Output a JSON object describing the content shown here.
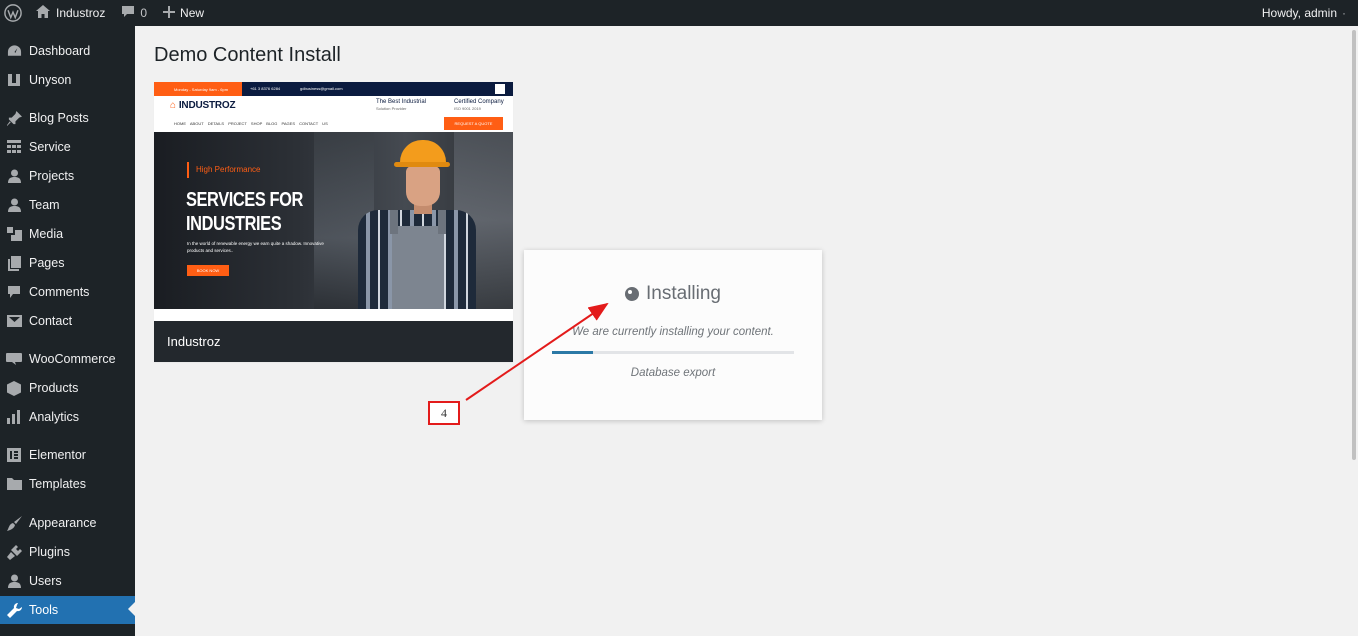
{
  "adminbar": {
    "site_name": "Industroz",
    "comments_count": "0",
    "new_label": "New",
    "greeting": "Howdy, admin",
    "greeting_suffix": "·"
  },
  "sidebar": {
    "items": [
      {
        "label": "Dashboard",
        "icon": "dashboard-icon"
      },
      {
        "label": "Unyson",
        "icon": "unyson-icon"
      },
      {
        "label": "Blog Posts",
        "icon": "pin-icon"
      },
      {
        "label": "Service",
        "icon": "grid-icon"
      },
      {
        "label": "Projects",
        "icon": "person-icon"
      },
      {
        "label": "Team",
        "icon": "person-icon"
      },
      {
        "label": "Media",
        "icon": "media-icon"
      },
      {
        "label": "Pages",
        "icon": "pages-icon"
      },
      {
        "label": "Comments",
        "icon": "comment-icon"
      },
      {
        "label": "Contact",
        "icon": "mail-icon"
      },
      {
        "label": "WooCommerce",
        "icon": "woo-icon"
      },
      {
        "label": "Products",
        "icon": "box-icon"
      },
      {
        "label": "Analytics",
        "icon": "bar-chart-icon"
      },
      {
        "label": "Elementor",
        "icon": "elementor-icon"
      },
      {
        "label": "Templates",
        "icon": "folder-icon"
      },
      {
        "label": "Appearance",
        "icon": "brush-icon"
      },
      {
        "label": "Plugins",
        "icon": "plug-icon"
      },
      {
        "label": "Users",
        "icon": "person-icon"
      },
      {
        "label": "Tools",
        "icon": "wrench-icon",
        "active": true
      }
    ]
  },
  "page": {
    "title": "Demo Content Install"
  },
  "theme": {
    "name": "Industroz",
    "preview": {
      "topbar_left": "Monday - Saturday 9am - 6pm",
      "topbar_phone": "+61 3 8376 6284",
      "topbar_email": "gdbusiness@gmail.com",
      "logo": "INDUSTROZ",
      "nav": "HOME ABOUT DETAILS PROJECT SHOP BLOG PAGES CONTACT US",
      "best_title": "The Best Industrial",
      "best_sub": "Solution Provider",
      "cert_title": "Certified Company",
      "cert_sub": "ISO 9001 2019",
      "quote_btn": "REQUEST A QUOTE",
      "tag": "High Performance",
      "headline_1": "SERVICES FOR",
      "headline_2": "INDUSTRIES",
      "paragraph": "In the world of renewable energy we earn quite a shadow. Innovative products and services..",
      "cta": "BOOK NOW"
    }
  },
  "installer": {
    "title": "Installing",
    "message": "We are currently installing your content.",
    "step": "Database export",
    "progress": 0.17
  },
  "annotation": {
    "label": "4"
  },
  "colors": {
    "admin_bg": "#1d2327",
    "active": "#2271b1",
    "progress": "#2b79a6",
    "annotation": "#e31b1b",
    "brand_orange": "#ff5e14"
  }
}
